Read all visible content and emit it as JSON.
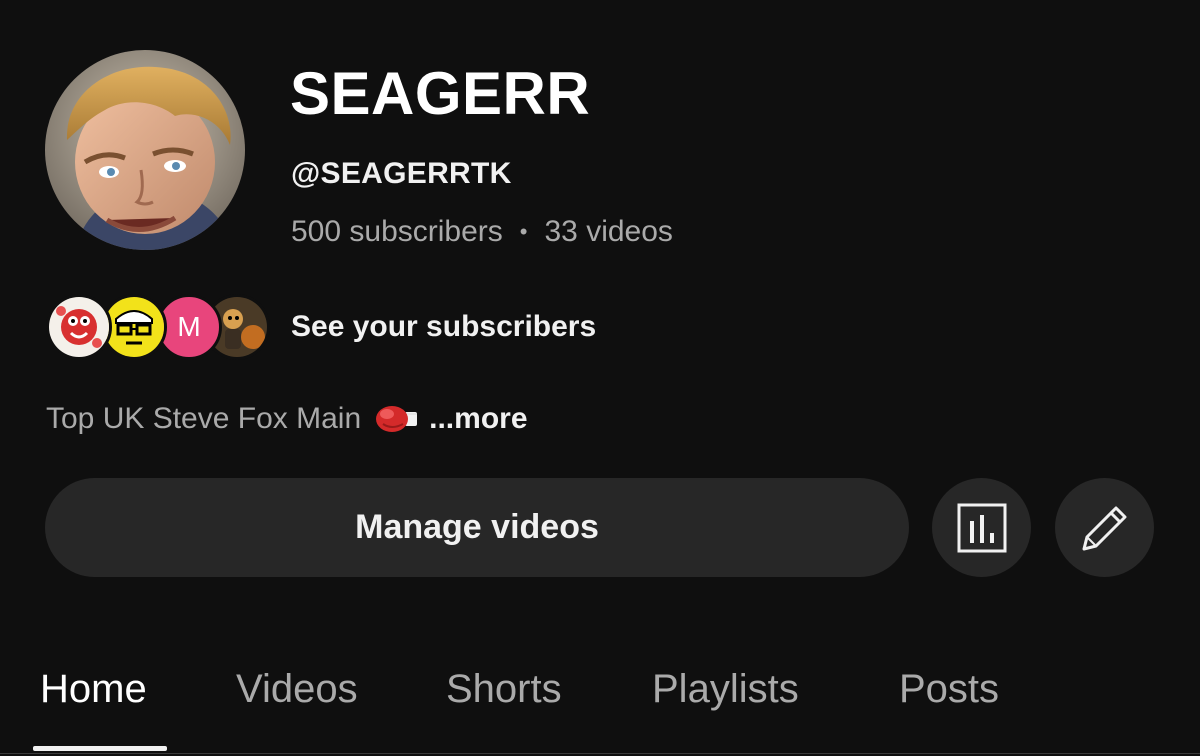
{
  "channel": {
    "name": "SEAGERR",
    "handle": "@SEAGERRTK",
    "subscribers": "500 subscribers",
    "separator": "•",
    "videos": "33 videos",
    "avatar_icon": "profile-avatar"
  },
  "subscribers_preview": {
    "link_label": "See your subscribers",
    "avatars": [
      {
        "icon": "subscriber-avatar-mascot"
      },
      {
        "icon": "subscriber-avatar-emoji"
      },
      {
        "letter": "M",
        "color": "#e8457c"
      },
      {
        "icon": "subscriber-avatar-character"
      }
    ]
  },
  "description": {
    "text": "Top UK Steve Fox Main",
    "emoji": "boxing-glove-icon",
    "more_label": "...more"
  },
  "actions": {
    "manage_label": "Manage videos",
    "analytics_icon": "analytics-icon",
    "edit_icon": "pencil-icon"
  },
  "tabs": [
    {
      "label": "Home",
      "active": true
    },
    {
      "label": "Videos",
      "active": false
    },
    {
      "label": "Shorts",
      "active": false
    },
    {
      "label": "Playlists",
      "active": false
    },
    {
      "label": "Posts",
      "active": false
    }
  ],
  "colors": {
    "background": "#0f0f0f",
    "button_bg": "#272727",
    "text_primary": "#f1f1f1",
    "text_secondary": "#aaaaaa"
  }
}
